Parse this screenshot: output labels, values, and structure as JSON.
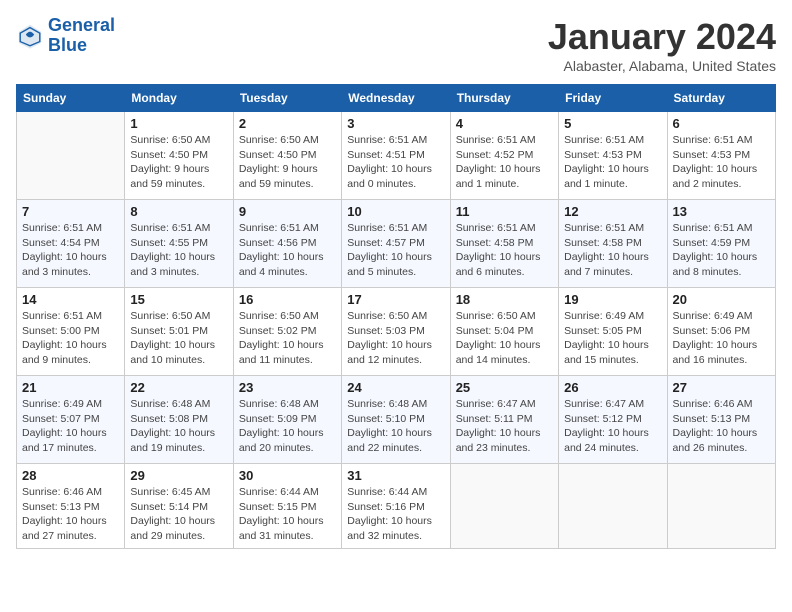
{
  "logo": {
    "line1": "General",
    "line2": "Blue"
  },
  "title": "January 2024",
  "subtitle": "Alabaster, Alabama, United States",
  "days_header": [
    "Sunday",
    "Monday",
    "Tuesday",
    "Wednesday",
    "Thursday",
    "Friday",
    "Saturday"
  ],
  "weeks": [
    [
      {
        "day": "",
        "info": ""
      },
      {
        "day": "1",
        "info": "Sunrise: 6:50 AM\nSunset: 4:50 PM\nDaylight: 9 hours\nand 59 minutes."
      },
      {
        "day": "2",
        "info": "Sunrise: 6:50 AM\nSunset: 4:50 PM\nDaylight: 9 hours\nand 59 minutes."
      },
      {
        "day": "3",
        "info": "Sunrise: 6:51 AM\nSunset: 4:51 PM\nDaylight: 10 hours\nand 0 minutes."
      },
      {
        "day": "4",
        "info": "Sunrise: 6:51 AM\nSunset: 4:52 PM\nDaylight: 10 hours\nand 1 minute."
      },
      {
        "day": "5",
        "info": "Sunrise: 6:51 AM\nSunset: 4:53 PM\nDaylight: 10 hours\nand 1 minute."
      },
      {
        "day": "6",
        "info": "Sunrise: 6:51 AM\nSunset: 4:53 PM\nDaylight: 10 hours\nand 2 minutes."
      }
    ],
    [
      {
        "day": "7",
        "info": "Sunrise: 6:51 AM\nSunset: 4:54 PM\nDaylight: 10 hours\nand 3 minutes."
      },
      {
        "day": "8",
        "info": "Sunrise: 6:51 AM\nSunset: 4:55 PM\nDaylight: 10 hours\nand 3 minutes."
      },
      {
        "day": "9",
        "info": "Sunrise: 6:51 AM\nSunset: 4:56 PM\nDaylight: 10 hours\nand 4 minutes."
      },
      {
        "day": "10",
        "info": "Sunrise: 6:51 AM\nSunset: 4:57 PM\nDaylight: 10 hours\nand 5 minutes."
      },
      {
        "day": "11",
        "info": "Sunrise: 6:51 AM\nSunset: 4:58 PM\nDaylight: 10 hours\nand 6 minutes."
      },
      {
        "day": "12",
        "info": "Sunrise: 6:51 AM\nSunset: 4:58 PM\nDaylight: 10 hours\nand 7 minutes."
      },
      {
        "day": "13",
        "info": "Sunrise: 6:51 AM\nSunset: 4:59 PM\nDaylight: 10 hours\nand 8 minutes."
      }
    ],
    [
      {
        "day": "14",
        "info": "Sunrise: 6:51 AM\nSunset: 5:00 PM\nDaylight: 10 hours\nand 9 minutes."
      },
      {
        "day": "15",
        "info": "Sunrise: 6:50 AM\nSunset: 5:01 PM\nDaylight: 10 hours\nand 10 minutes."
      },
      {
        "day": "16",
        "info": "Sunrise: 6:50 AM\nSunset: 5:02 PM\nDaylight: 10 hours\nand 11 minutes."
      },
      {
        "day": "17",
        "info": "Sunrise: 6:50 AM\nSunset: 5:03 PM\nDaylight: 10 hours\nand 12 minutes."
      },
      {
        "day": "18",
        "info": "Sunrise: 6:50 AM\nSunset: 5:04 PM\nDaylight: 10 hours\nand 14 minutes."
      },
      {
        "day": "19",
        "info": "Sunrise: 6:49 AM\nSunset: 5:05 PM\nDaylight: 10 hours\nand 15 minutes."
      },
      {
        "day": "20",
        "info": "Sunrise: 6:49 AM\nSunset: 5:06 PM\nDaylight: 10 hours\nand 16 minutes."
      }
    ],
    [
      {
        "day": "21",
        "info": "Sunrise: 6:49 AM\nSunset: 5:07 PM\nDaylight: 10 hours\nand 17 minutes."
      },
      {
        "day": "22",
        "info": "Sunrise: 6:48 AM\nSunset: 5:08 PM\nDaylight: 10 hours\nand 19 minutes."
      },
      {
        "day": "23",
        "info": "Sunrise: 6:48 AM\nSunset: 5:09 PM\nDaylight: 10 hours\nand 20 minutes."
      },
      {
        "day": "24",
        "info": "Sunrise: 6:48 AM\nSunset: 5:10 PM\nDaylight: 10 hours\nand 22 minutes."
      },
      {
        "day": "25",
        "info": "Sunrise: 6:47 AM\nSunset: 5:11 PM\nDaylight: 10 hours\nand 23 minutes."
      },
      {
        "day": "26",
        "info": "Sunrise: 6:47 AM\nSunset: 5:12 PM\nDaylight: 10 hours\nand 24 minutes."
      },
      {
        "day": "27",
        "info": "Sunrise: 6:46 AM\nSunset: 5:13 PM\nDaylight: 10 hours\nand 26 minutes."
      }
    ],
    [
      {
        "day": "28",
        "info": "Sunrise: 6:46 AM\nSunset: 5:13 PM\nDaylight: 10 hours\nand 27 minutes."
      },
      {
        "day": "29",
        "info": "Sunrise: 6:45 AM\nSunset: 5:14 PM\nDaylight: 10 hours\nand 29 minutes."
      },
      {
        "day": "30",
        "info": "Sunrise: 6:44 AM\nSunset: 5:15 PM\nDaylight: 10 hours\nand 31 minutes."
      },
      {
        "day": "31",
        "info": "Sunrise: 6:44 AM\nSunset: 5:16 PM\nDaylight: 10 hours\nand 32 minutes."
      },
      {
        "day": "",
        "info": ""
      },
      {
        "day": "",
        "info": ""
      },
      {
        "day": "",
        "info": ""
      }
    ]
  ]
}
